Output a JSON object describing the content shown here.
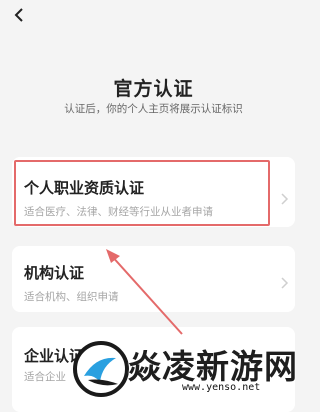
{
  "header": {
    "back_icon": "chevron-left-icon",
    "title": "官方认证",
    "subtitle": "认证后，你的个人主页将展示认证标识"
  },
  "cards": [
    {
      "title": "个人职业资质认证",
      "desc": "适合医疗、法律、财经等行业从业者申请",
      "highlighted": true
    },
    {
      "title": "机构认证",
      "desc": "适合机构、组织申请",
      "highlighted": false
    },
    {
      "title": "企业认证",
      "desc": "适合企业",
      "highlighted": false
    }
  ],
  "annotation": {
    "color": "#e46a6a"
  },
  "watermark": {
    "text": "焱凌新游网",
    "url": "www.yenso.net"
  }
}
